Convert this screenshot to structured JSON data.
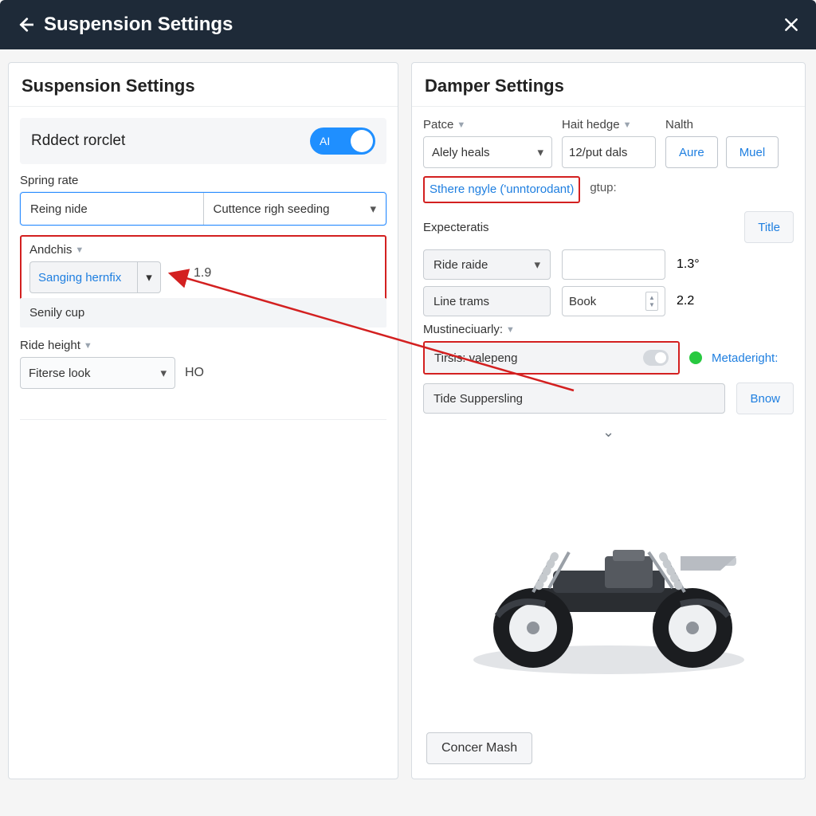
{
  "titlebar": {
    "title": "Suspension Settings"
  },
  "left": {
    "heading": "Suspension Settings",
    "toggle": {
      "label": "Rddect rorclet",
      "switch_text": "AI"
    },
    "spring_label": "Spring rate",
    "spring_left": "Reing nide",
    "spring_right": "Cuttence righ seeding",
    "andchis_label": "Andchis",
    "andchis_value": "Sanging hernfix",
    "andchis_out": "1.9",
    "senily": "Senily cup",
    "ride_height_label": "Ride height",
    "ride_height_value": "Fiterse look",
    "ride_height_out": "HO"
  },
  "right": {
    "heading": "Damper Settings",
    "col1_label": "Patce",
    "col1_value": "Alely heals",
    "col2_label": "Hait hedge",
    "col2_value": "12/put dals",
    "col3_label": "Nalth",
    "btn_aure": "Aure",
    "btn_muel": "Muel",
    "sthere": "Sthere ngyle ('unntorodant)",
    "gtup": "gtup:",
    "exp_label": "Expecteratis",
    "title_btn": "Title",
    "ride_raide": "Ride raide",
    "ride_raide_out": "1.3°",
    "line_trams": "Line trams",
    "book": "Book",
    "book_out": "2.2",
    "must_label": "Mustineciuarly:",
    "tirsis": "Tirsis: valepeng",
    "metadaright": "Metaderight:",
    "tide": "Tide Suppersling",
    "bnow": "Bnow",
    "footer_btn": "Concer Mash"
  }
}
